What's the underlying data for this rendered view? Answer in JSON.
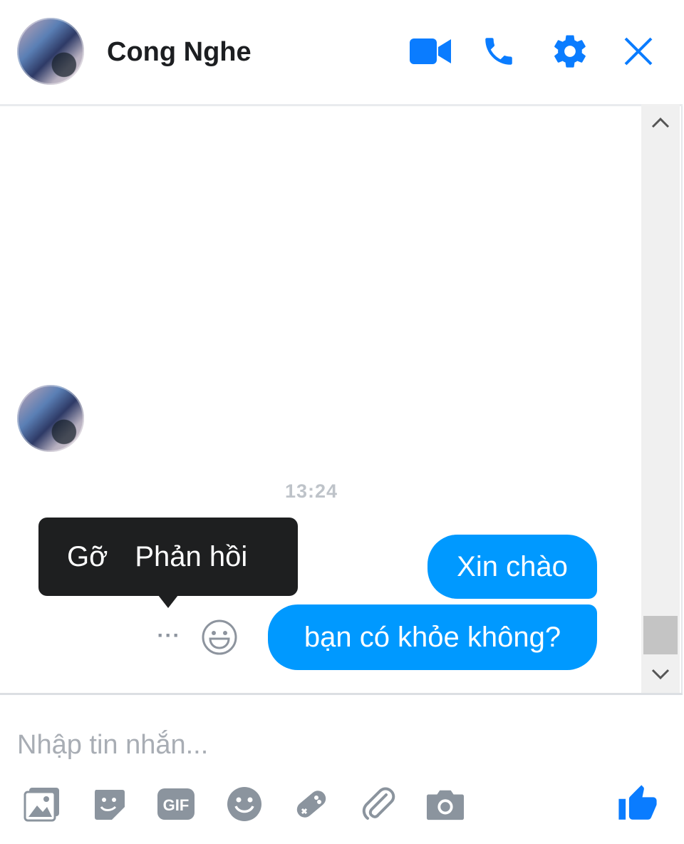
{
  "header": {
    "title": "Cong Nghe",
    "icons": [
      "video-call-icon",
      "phone-icon",
      "gear-icon",
      "close-icon"
    ]
  },
  "conversation": {
    "timestamp": "13:24",
    "tooltip": {
      "remove_label": "Gỡ",
      "reply_label": "Phản hồi"
    },
    "more_glyph": "···",
    "messages": [
      {
        "text": "Xin chào",
        "sender": "me"
      },
      {
        "text": "bạn có khỏe không?",
        "sender": "me"
      }
    ]
  },
  "composer": {
    "placeholder": "Nhập tin nhắn...",
    "tools": [
      "photo-icon",
      "sticker-icon",
      "gif-icon",
      "emoji-icon",
      "game-icon",
      "attachment-icon",
      "camera-icon"
    ],
    "send_icon": "thumbs-up-icon"
  },
  "colors": {
    "accent": "#0a7cff",
    "bubble": "#0099ff",
    "tooltip_bg": "#1e1f20"
  }
}
